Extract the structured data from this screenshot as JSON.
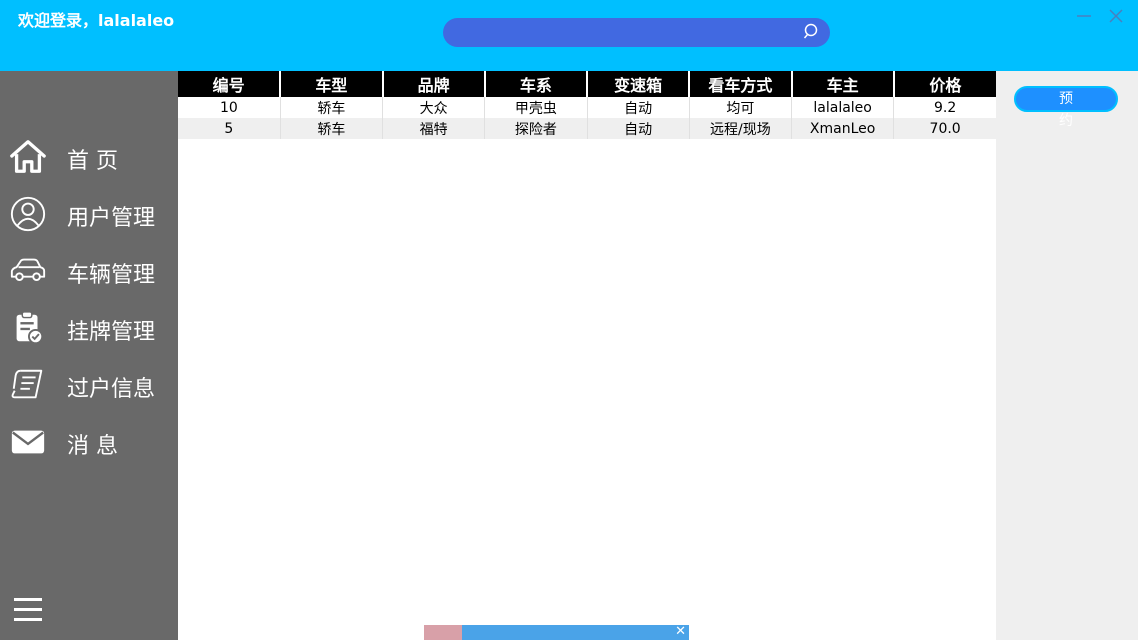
{
  "header": {
    "welcome": "欢迎登录，lalalaleo",
    "search_placeholder": ""
  },
  "sidebar": {
    "items": [
      {
        "label": "首 页",
        "icon": "home-icon"
      },
      {
        "label": "用户管理",
        "icon": "user-icon"
      },
      {
        "label": "车辆管理",
        "icon": "car-icon"
      },
      {
        "label": "挂牌管理",
        "icon": "clipboard-check-icon"
      },
      {
        "label": "过户信息",
        "icon": "document-icon"
      },
      {
        "label": "消  息",
        "icon": "mail-icon"
      }
    ]
  },
  "table": {
    "columns": [
      "编号",
      "车型",
      "品牌",
      "车系",
      "变速箱",
      "看车方式",
      "车主",
      "价格"
    ],
    "rows": [
      [
        "10",
        "轿车",
        "大众",
        "甲壳虫",
        "自动",
        "均可",
        "lalalaleo",
        "9.2"
      ],
      [
        "5",
        "轿车",
        "福特",
        "探险者",
        "自动",
        "远程/现场",
        "XmanLeo",
        "70.0"
      ]
    ]
  },
  "actions": {
    "book_label": "预约"
  },
  "colors": {
    "header_bg": "#00bfff",
    "search_bg": "#4169e1",
    "sidebar_bg": "#696969",
    "table_header_bg": "#000000",
    "button_bg": "#1e90ff"
  }
}
